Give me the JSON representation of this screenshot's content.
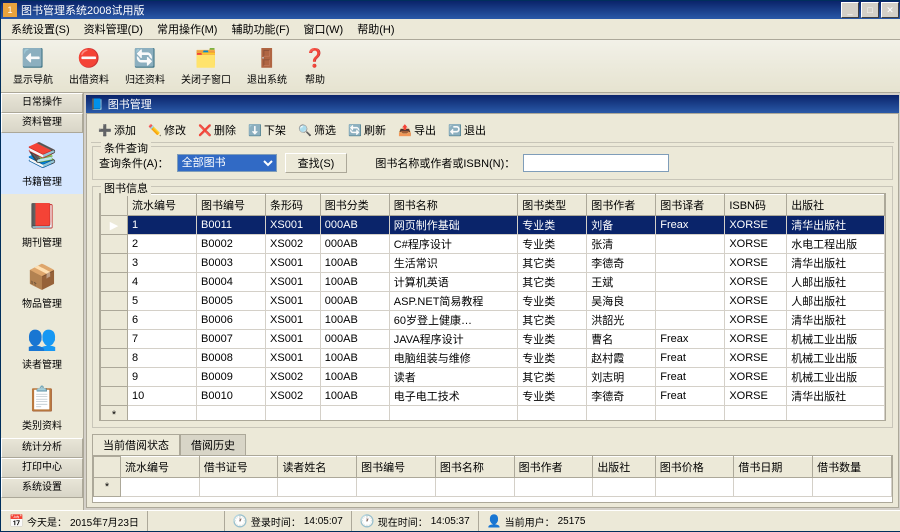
{
  "titlebar": {
    "icon_text": "1",
    "title": "图书管理系统2008试用版"
  },
  "menubar": [
    "系统设置(S)",
    "资料管理(D)",
    "常用操作(M)",
    "辅助功能(F)",
    "窗口(W)",
    "帮助(H)"
  ],
  "toolbar": [
    {
      "icon": "⬅️",
      "color": "#1e6db4",
      "label": "显示导航"
    },
    {
      "icon": "⛔",
      "color": "#d97a17",
      "label": "出借资料"
    },
    {
      "icon": "🔄",
      "color": "#3da23d",
      "label": "归还资料"
    },
    {
      "icon": "🗂️",
      "color": "#d9a417",
      "label": "关闭子窗口"
    },
    {
      "icon": "🚪",
      "color": "#b44b1e",
      "label": "退出系统"
    },
    {
      "icon": "❓",
      "color": "#c43a3a",
      "label": "帮助"
    }
  ],
  "sidebar": {
    "heads_top": [
      "日常操作",
      "资料管理"
    ],
    "items": [
      {
        "icon": "📚",
        "color": "#1e3a6d",
        "label": "书籍管理",
        "selected": true
      },
      {
        "icon": "📕",
        "color": "#6d1e3a",
        "label": "期刊管理"
      },
      {
        "icon": "📦",
        "color": "#b47a1e",
        "label": "物品管理"
      },
      {
        "icon": "👥",
        "color": "#b43a6d",
        "label": "读者管理"
      },
      {
        "icon": "📋",
        "color": "#b41e1e",
        "label": "类别资料"
      }
    ],
    "heads_bottom": [
      "统计分析",
      "打印中心",
      "系统设置"
    ]
  },
  "child": {
    "icon": "📘",
    "title": "图书管理",
    "toolbar": [
      {
        "icon": "➕",
        "label": "添加"
      },
      {
        "icon": "✏️",
        "label": "修改"
      },
      {
        "icon": "❌",
        "label": "删除"
      },
      {
        "icon": "⬇️",
        "label": "下架"
      },
      {
        "icon": "🔍",
        "label": "筛选"
      },
      {
        "icon": "🔄",
        "label": "刷新"
      },
      {
        "icon": "📤",
        "label": "导出"
      },
      {
        "icon": "↩️",
        "label": "退出"
      }
    ],
    "query": {
      "legend": "条件查询",
      "label1": "查询条件(A)：",
      "combo_value": "全部图书",
      "btn": "查找(S)",
      "label2": "图书名称或作者或ISBN(N)："
    },
    "info": {
      "legend": "图书信息"
    },
    "columns": [
      "流水编号",
      "图书编号",
      "条形码",
      "图书分类",
      "图书名称",
      "图书类型",
      "图书作者",
      "图书译者",
      "ISBN码",
      "出版社"
    ],
    "rows": [
      [
        "1",
        "B0011",
        "XS001",
        "000AB",
        "网页制作基础",
        "专业类",
        "刘备",
        "Freax",
        "XORSE",
        "清华出版社"
      ],
      [
        "2",
        "B0002",
        "XS002",
        "000AB",
        "C#程序设计",
        "专业类",
        "张清",
        "",
        "XORSE",
        "水电工程出版"
      ],
      [
        "3",
        "B0003",
        "XS001",
        "100AB",
        "生活常识",
        "其它类",
        "李德奇",
        "",
        "XORSE",
        "清华出版社"
      ],
      [
        "4",
        "B0004",
        "XS001",
        "100AB",
        "计算机英语",
        "其它类",
        "王斌",
        "",
        "XORSE",
        "人邮出版社"
      ],
      [
        "5",
        "B0005",
        "XS001",
        "000AB",
        "ASP.NET简易教程",
        "专业类",
        "吴海良",
        "",
        "XORSE",
        "人邮出版社"
      ],
      [
        "6",
        "B0006",
        "XS001",
        "100AB",
        "60岁登上健康…",
        "其它类",
        "洪韶光",
        "",
        "XORSE",
        "清华出版社"
      ],
      [
        "7",
        "B0007",
        "XS001",
        "000AB",
        "JAVA程序设计",
        "专业类",
        "曹名",
        "Freax",
        "XORSE",
        "机械工业出版"
      ],
      [
        "8",
        "B0008",
        "XS001",
        "100AB",
        "电脑组装与维修",
        "专业类",
        "赵村霞",
        "Freat",
        "XORSE",
        "机械工业出版"
      ],
      [
        "9",
        "B0009",
        "XS002",
        "100AB",
        "读者",
        "其它类",
        "刘志明",
        "Freat",
        "XORSE",
        "机械工业出版"
      ],
      [
        "10",
        "B0010",
        "XS002",
        "100AB",
        "电子电工技术",
        "专业类",
        "李德奇",
        "Freat",
        "XORSE",
        "清华出版社"
      ]
    ],
    "tabs": [
      "当前借阅状态",
      "借阅历史"
    ],
    "columns2": [
      "流水编号",
      "借书证号",
      "读者姓名",
      "图书编号",
      "图书名称",
      "图书作者",
      "出版社",
      "图书价格",
      "借书日期",
      "借书数量"
    ]
  },
  "status": {
    "today_label": "今天是：",
    "today": "2015年7月23日",
    "login_label": "登录时间：",
    "login": "14:05:07",
    "now_label": "现在时间：",
    "now": "14:05:37",
    "user_label": "当前用户：",
    "user": "25175"
  }
}
